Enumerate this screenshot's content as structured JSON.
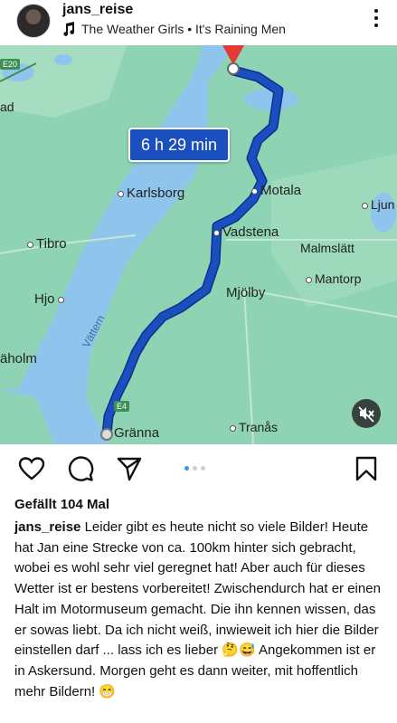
{
  "post": {
    "username": "jans_reise",
    "music": "The Weather Girls • It's Raining Men",
    "likes": "Gefällt 104 Mal",
    "caption_user": "jans_reise",
    "caption_text": "Leider gibt es heute nicht so viele Bilder! Heute hat Jan eine Strecke von ca. 100km hinter sich gebracht, wobei es wohl sehr viel geregnet hat! Aber auch für dieses Wetter ist er bestens vorbereitet! Zwischendurch hat er einen Halt im Motormuseum gemacht. Die ihn kennen wissen, das er sowas liebt. Da ich nicht weiß, inwieweit ich hier die Bilder einstellen darf ... lass ich es lieber 🤔😅 Angekommen ist er in Askersund. Morgen geht es dann weiter, mit hoffentlich mehr Bildern! 😁",
    "carousel": {
      "count": 3,
      "active": 1
    }
  },
  "map": {
    "duration": "6 h 29 min",
    "lake": "Vättern",
    "roads": {
      "e20": "E20",
      "e4": "E4"
    },
    "places": {
      "karlsborg": "Karlsborg",
      "motala": "Motala",
      "vadstena": "Vadstena",
      "tibro": "Tibro",
      "malmslatt": "Malmslätt",
      "mantorp": "Mantorp",
      "mjolby": "Mjölby",
      "hjo": "Hjo",
      "haholm": "äholm",
      "granna": "Gränna",
      "tranas": "Tranås",
      "ljun": "Ljun",
      "ad": "ad"
    },
    "colors": {
      "route": "#1a4fc0",
      "water": "#8fc5ec",
      "land": "#8fd3b5",
      "destination": "#e53935"
    }
  },
  "icons": {
    "music": "music-note-icon",
    "more": "more-vertical-icon",
    "like": "heart-icon",
    "comment": "comment-icon",
    "share": "send-icon",
    "save": "bookmark-icon",
    "mute": "speaker-muted-icon"
  }
}
